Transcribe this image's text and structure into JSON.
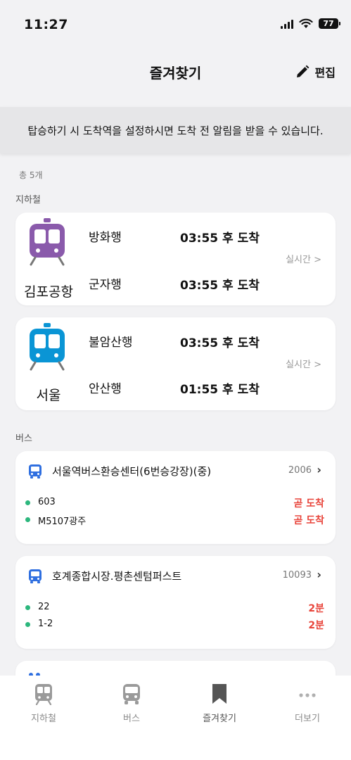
{
  "status_bar": {
    "time": "11:27",
    "battery": "77"
  },
  "header": {
    "title": "즐겨찾기",
    "edit_label": "편집"
  },
  "notice": "탑승하기 시 도착역을 설정하시면 도착 전 알림을 받을 수 있습니다.",
  "total_count": "총 5개",
  "subway": {
    "section_label": "지하철",
    "stations": [
      {
        "name": "김포공항",
        "line_color": "#8a5aab",
        "realtime_label": "실시간 >",
        "arrivals": [
          {
            "direction": "방화행",
            "eta": "03:55 후 도착"
          },
          {
            "direction": "군자행",
            "eta": "03:55 후 도착"
          }
        ]
      },
      {
        "name": "서울",
        "line_color": "#0a95d5",
        "realtime_label": "실시간 >",
        "arrivals": [
          {
            "direction": "불암산행",
            "eta": "03:55 후 도착"
          },
          {
            "direction": "안산행",
            "eta": "01:55 후 도착"
          }
        ]
      }
    ]
  },
  "bus": {
    "section_label": "버스",
    "stops": [
      {
        "name": "서울역버스환승센터(6번승강장)(중)",
        "stop_id": "2006",
        "routes": [
          {
            "number": "603",
            "eta": "곧 도착"
          },
          {
            "number": "M5107광주",
            "eta": "곧 도착"
          }
        ]
      },
      {
        "name": "호계종합시장.평촌센텀퍼스트",
        "stop_id": "10093",
        "routes": [
          {
            "number": "22",
            "eta": "2분"
          },
          {
            "number": "1-2",
            "eta": "2분"
          }
        ]
      }
    ]
  },
  "tab_bar": {
    "tabs": [
      {
        "label": "지하철",
        "icon": "train-icon"
      },
      {
        "label": "버스",
        "icon": "bus-icon"
      },
      {
        "label": "즐겨찾기",
        "icon": "bookmark-icon",
        "active": true
      },
      {
        "label": "더보기",
        "icon": "more-icon"
      }
    ]
  },
  "colors": {
    "bus_blue": "#2f6fe0",
    "route_dot": "#2cb77d",
    "eta_red": "#e8443a"
  }
}
